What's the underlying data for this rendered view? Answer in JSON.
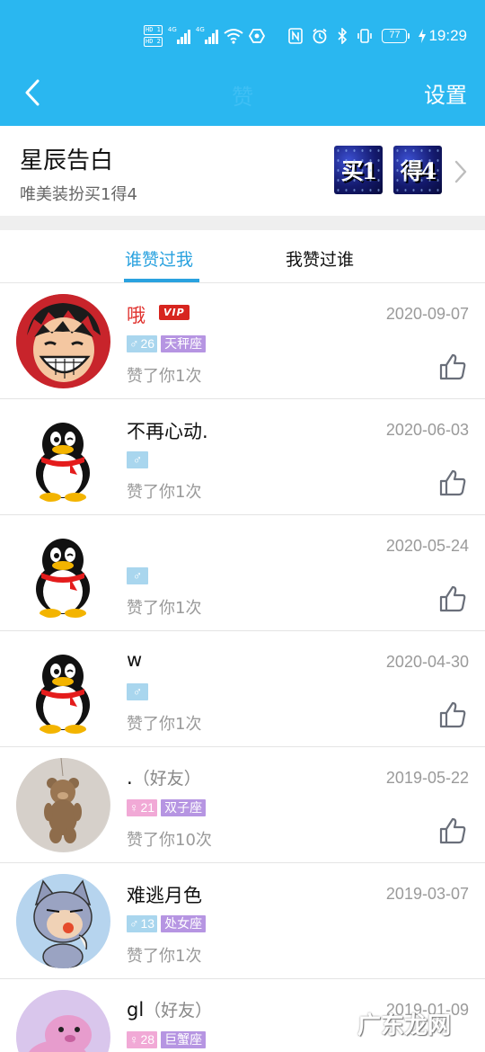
{
  "status_bar": {
    "network_labels": [
      "HD 1",
      "HD 2"
    ],
    "sim1_net": "4G",
    "sim2_net": "4G",
    "battery": "77",
    "time": "19:29"
  },
  "header": {
    "title": "赞",
    "settings_label": "设置"
  },
  "promo": {
    "title": "星辰告白",
    "subtitle": "唯美装扮买1得4",
    "image1_text": "买1",
    "image2_text": "得4"
  },
  "tabs": [
    {
      "label": "谁赞过我",
      "active": true
    },
    {
      "label": "我赞过谁",
      "active": false
    }
  ],
  "likes": [
    {
      "name": "哦",
      "vip": "VIP",
      "friend": "",
      "date": "2020-09-07",
      "gender": "male",
      "gender_symbol": "♂",
      "age": "26",
      "zodiac": "天秤座",
      "liked_text": "赞了你1次",
      "avatar": "cartoon-boy-avatar"
    },
    {
      "name": "不再心动.",
      "vip": "",
      "friend": "",
      "date": "2020-06-03",
      "gender": "male",
      "gender_symbol": "♂",
      "age": "",
      "zodiac": "",
      "liked_text": "赞了你1次",
      "avatar": "penguin-avatar"
    },
    {
      "name": "",
      "vip": "",
      "friend": "",
      "date": "2020-05-24",
      "gender": "male",
      "gender_symbol": "♂",
      "age": "",
      "zodiac": "",
      "liked_text": "赞了你1次",
      "avatar": "penguin-avatar"
    },
    {
      "name": "w",
      "vip": "",
      "friend": "",
      "date": "2020-04-30",
      "gender": "male",
      "gender_symbol": "♂",
      "age": "",
      "zodiac": "",
      "liked_text": "赞了你1次",
      "avatar": "penguin-avatar"
    },
    {
      "name": ".",
      "vip": "",
      "friend": "（好友）",
      "date": "2019-05-22",
      "gender": "female",
      "gender_symbol": "♀",
      "age": "21",
      "zodiac": "双子座",
      "liked_text": "赞了你10次",
      "avatar": "teddy-bear-avatar"
    },
    {
      "name": "难逃月色",
      "vip": "",
      "friend": "",
      "date": "2019-03-07",
      "gender": "male",
      "gender_symbol": "♂",
      "age": "13",
      "zodiac": "处女座",
      "liked_text": "赞了你1次",
      "avatar": "cartoon-cat-avatar"
    },
    {
      "name": "gl",
      "vip": "",
      "friend": "（好友）",
      "date": "2019-01-09",
      "gender": "female",
      "gender_symbol": "♀",
      "age": "28",
      "zodiac": "巨蟹座",
      "liked_text": "",
      "avatar": "pink-seal-avatar"
    }
  ],
  "watermark": "广东龙网",
  "colors": {
    "accent": "#2ab7f0",
    "tab_active": "#2aa2df",
    "vip_red": "#d7251f",
    "male_tag": "#a9d6ee",
    "female_tag": "#f1a9d6",
    "zodiac_tag": "#b695e2"
  }
}
